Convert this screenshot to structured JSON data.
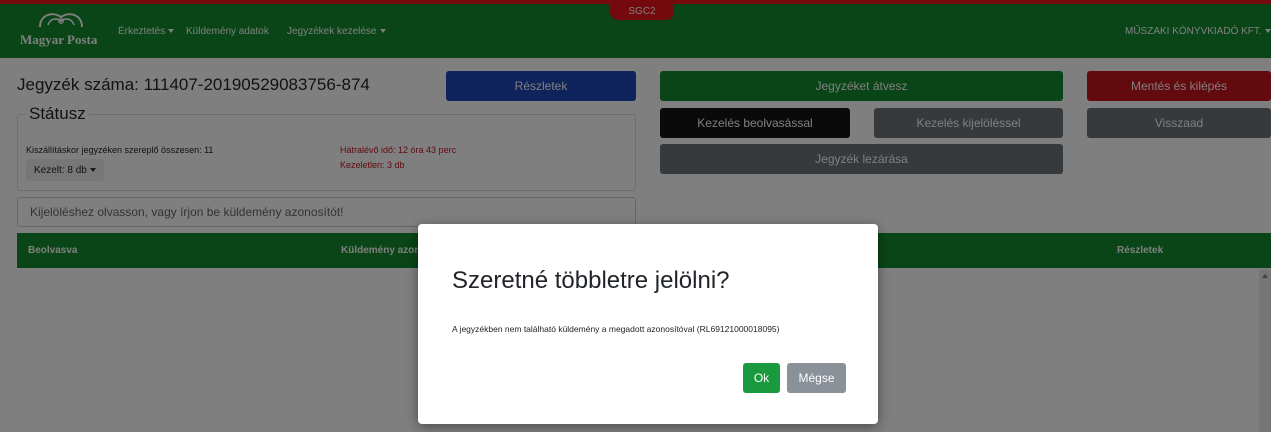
{
  "app": {
    "env_badge": "SGC2",
    "logo_text": "Magyar Posta"
  },
  "nav": {
    "items": [
      "Érkeztetés",
      "Küldemény adatok",
      "Jegyzékek kezelése"
    ],
    "user": "MŰSZAKI KÖNYVKIADÓ KFT."
  },
  "header": {
    "title": "Jegyzék száma: 111407-20190529083756-874"
  },
  "buttons": {
    "reszletek": "Részletek",
    "jegyzeket_atvesz": "Jegyzéket átvesz",
    "mentes_kilepes": "Mentés és kilépés",
    "kezeles_beolvasassal": "Kezelés beolvasással",
    "kezeles_kijelolessel": "Kezelés kijelöléssel",
    "visszaad": "Visszaad",
    "jegyzek_lezarasa": "Jegyzék lezárása"
  },
  "status": {
    "legend": "Státusz",
    "total": "Kiszállításkor jegyzéken szereplő összesen: 11",
    "remaining_time": "Hátralévő idő: 12 óra 43 perc",
    "unhandled": "Kezeletlen: 3 db",
    "handled": "Kezelt: 8 db"
  },
  "search": {
    "placeholder": "Kijelöléshez olvasson, vagy írjon be küldemény azonosítót!"
  },
  "table": {
    "headers": [
      "Beolvasva",
      "Küldemény azonosító",
      "Részletek"
    ]
  },
  "modal": {
    "title": "Szeretné többletre jelölni?",
    "body": "A jegyzékben nem található küldemény a megadott azonosítóval (RL69121000018095)",
    "ok": "Ok",
    "cancel": "Mégse"
  },
  "colors": {
    "brand_green": "#138a2d",
    "env_red": "#e8141b",
    "primary_blue": "#1f47b8",
    "danger_red": "#c7151f",
    "dark": "#141414",
    "secondary_gray": "#6c747b",
    "ok_green": "#1a9a3f",
    "cancel_gray": "#8a9198"
  }
}
